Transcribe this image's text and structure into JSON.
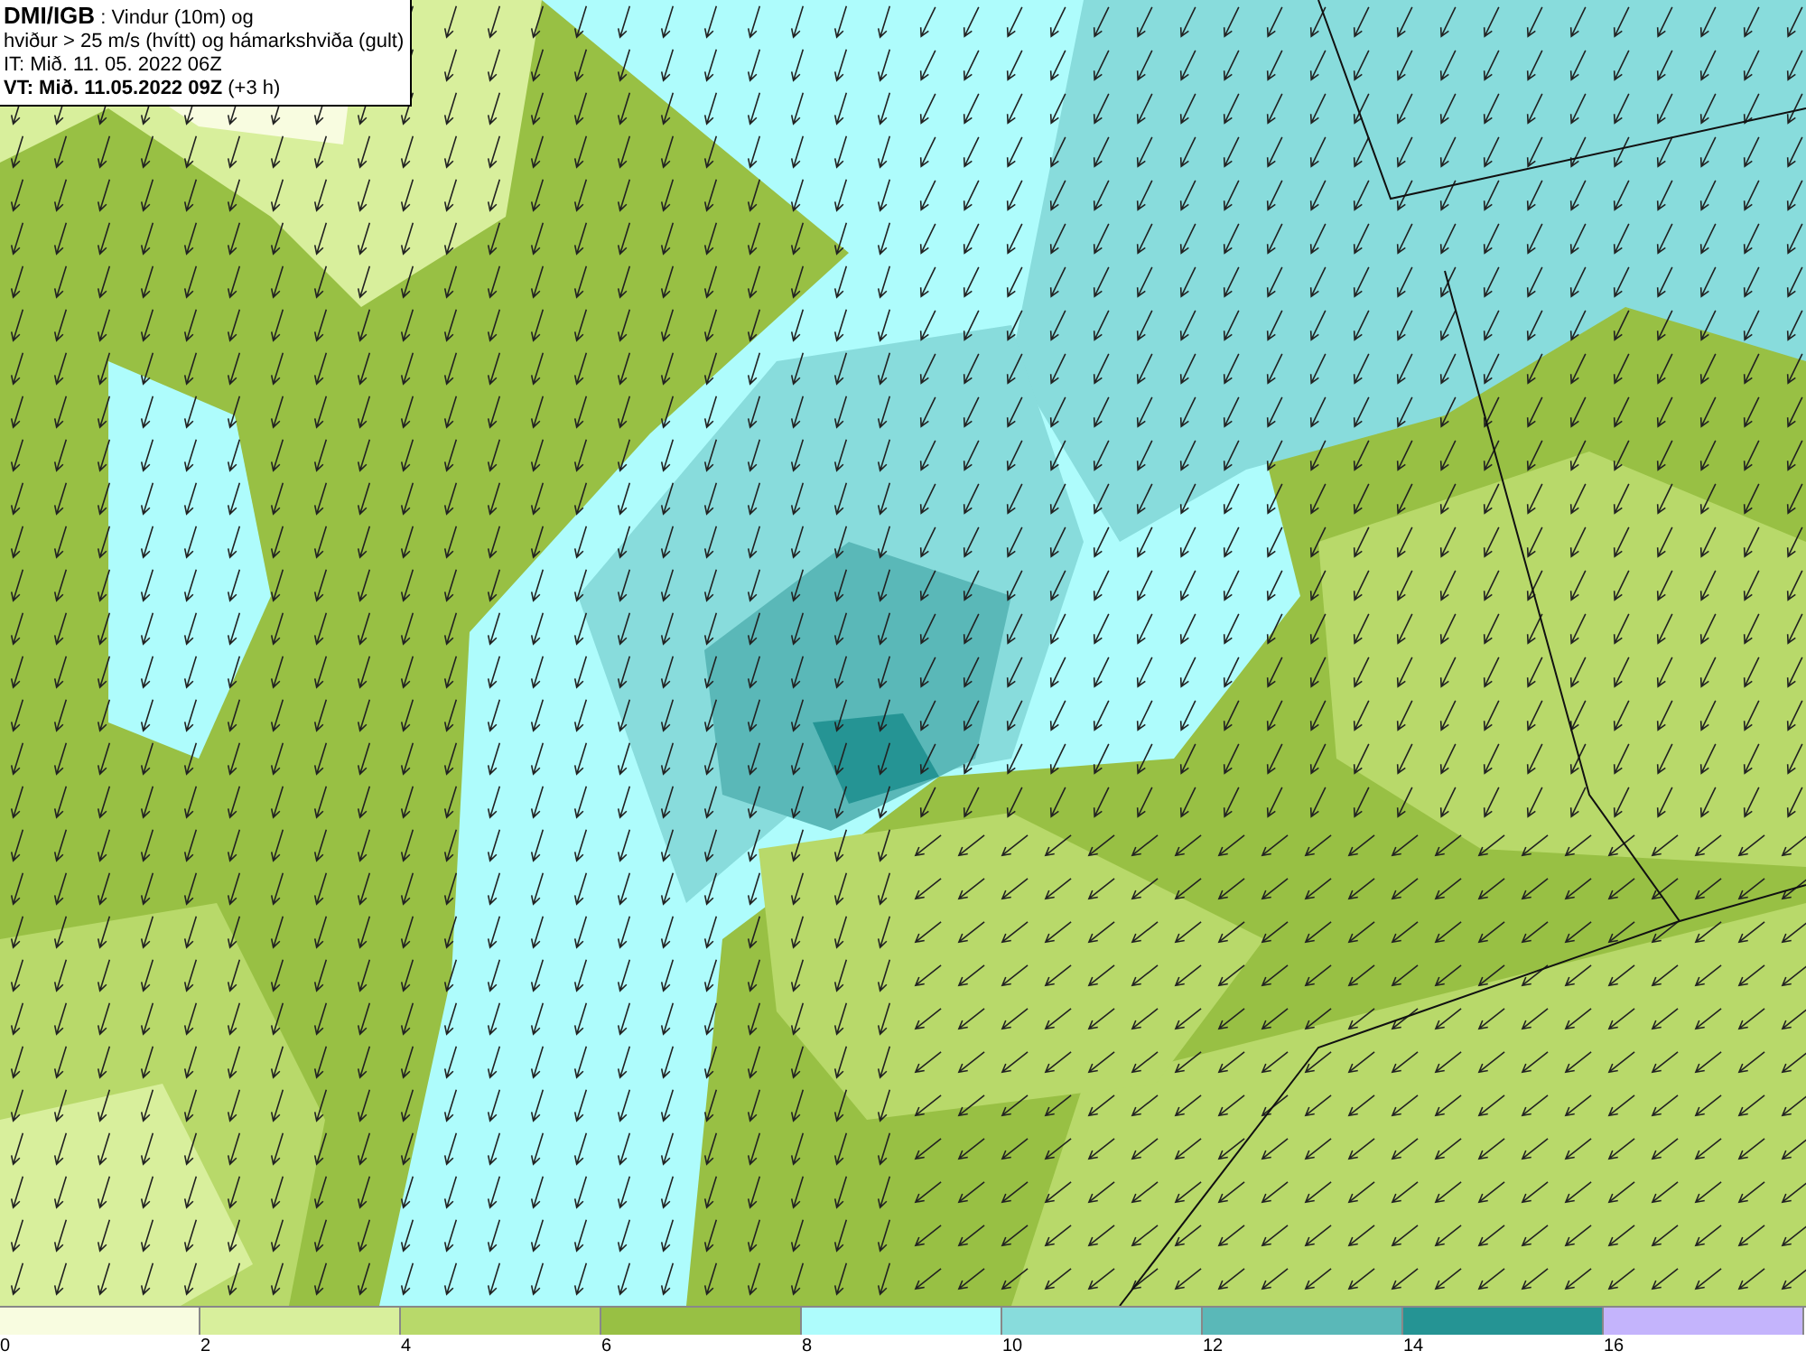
{
  "title_box": {
    "lines": [
      "**DMI/IGB** : Vindur (10m) og",
      "hviður > 25 m/s (hvítt) og hámarkshviða (gult)",
      "IT: Mið. 11. 05. 2022 06Z",
      "**VT: Mið. 11.05.2022 09Z** (+3 h)"
    ]
  },
  "legend": {
    "bins": [
      {
        "color": "#f8fce0"
      },
      {
        "color": "#d8ef9c"
      },
      {
        "color": "#b8d96a"
      },
      {
        "color": "#98c044"
      },
      {
        "color": "#aefcfc"
      },
      {
        "color": "#88dcdc"
      },
      {
        "color": "#5ab8b8"
      },
      {
        "color": "#259494"
      },
      {
        "color": "#c4b4fc"
      }
    ],
    "ticks": [
      "0",
      "2",
      "4",
      "6",
      "8",
      "10",
      "12",
      "14",
      "16"
    ]
  }
}
